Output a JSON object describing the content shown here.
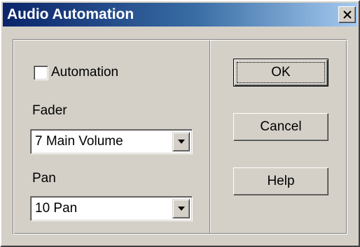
{
  "window": {
    "title": "Audio Automation",
    "close_icon": "close-icon"
  },
  "left_panel": {
    "automation_checkbox": {
      "label": "Automation",
      "checked": false
    },
    "fader": {
      "label": "Fader",
      "selected": "7 Main Volume"
    },
    "pan": {
      "label": "Pan",
      "selected": "10 Pan"
    }
  },
  "buttons": {
    "ok_label": "OK",
    "cancel_label": "Cancel",
    "help_label": "Help"
  },
  "colors": {
    "face": "#d4d0c8",
    "title_gradient_start": "#0a246a",
    "title_gradient_end": "#a6caf0"
  }
}
